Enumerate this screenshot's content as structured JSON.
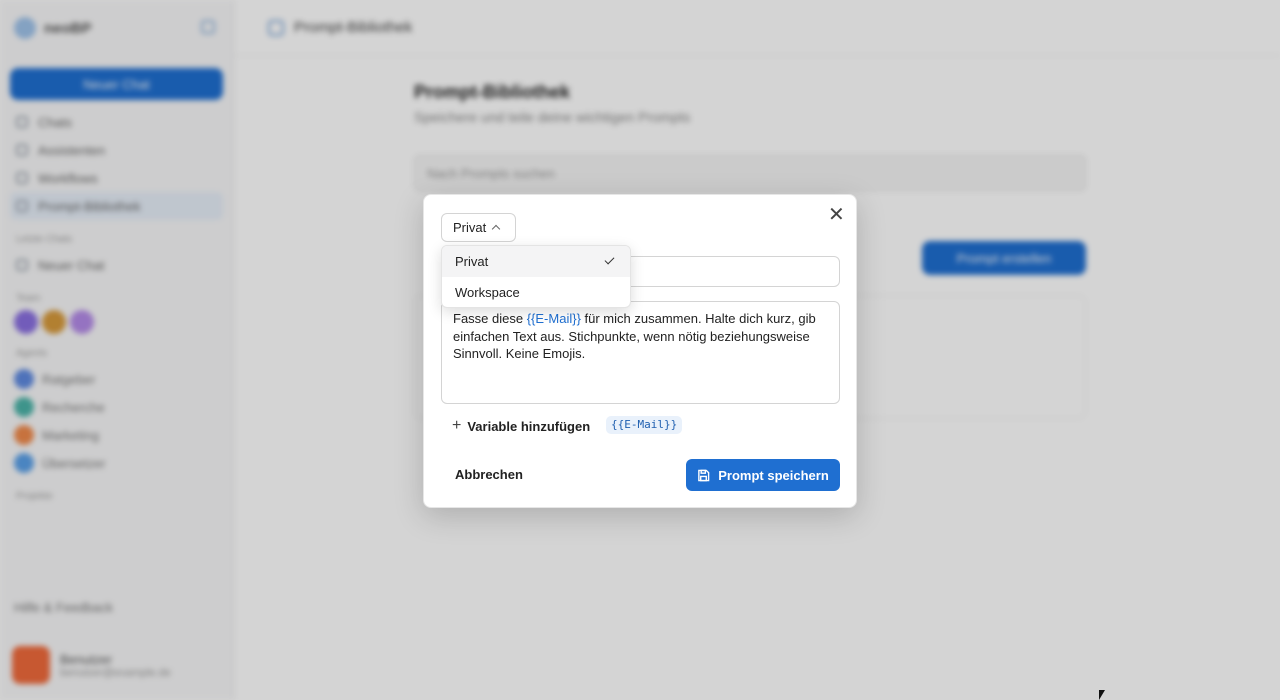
{
  "app": {
    "brand": "neoBP",
    "new_chat_label": "Neuer Chat",
    "nav": [
      {
        "label": "Chats"
      },
      {
        "label": "Assistenten"
      },
      {
        "label": "Workflows"
      },
      {
        "label": "Prompt-Bibliothek"
      }
    ],
    "section_recent": "Letzte Chats",
    "recent_item": "Neuer Chat",
    "section_team": "Team",
    "section_agents": "Agents",
    "agents": [
      {
        "label": "Ratgeber"
      },
      {
        "label": "Recherche"
      },
      {
        "label": "Marketing"
      },
      {
        "label": "Übersetzer"
      }
    ],
    "section_projects": "Projekte",
    "footer_link": "Hilfe & Feedback",
    "user_name": "Benutzer",
    "user_mail": "benutzer@example.de",
    "page_header": "Prompt-Bibliothek",
    "page_title": "Prompt-Bibliothek",
    "page_subtitle": "Speichere und teile deine wichtigen Prompts",
    "search_placeholder": "Nach Prompts suchen",
    "new_prompt_label": "Prompt erstellen"
  },
  "modal": {
    "scope_value": "Privat",
    "title_value": "",
    "prompt_text_before": "Fasse diese ",
    "prompt_variable": "{{E-Mail}}",
    "prompt_text_after": " für mich zusammen. Halte dich kurz, gib einfachen Text aus. Stichpunkte, wenn nötig beziehungsweise Sinnvoll. Keine Emojis.",
    "add_variable_label": "Variable hinzufügen",
    "variable_chip": "{{E-Mail}}",
    "cancel_label": "Abbrechen",
    "save_label": "Prompt speichern"
  },
  "dropdown": {
    "options": [
      {
        "label": "Privat",
        "selected": true
      },
      {
        "label": "Workspace",
        "selected": false
      }
    ]
  },
  "colors": {
    "accent": "#1f6fd1",
    "overlay": "rgba(0,0,0,0.17)"
  }
}
